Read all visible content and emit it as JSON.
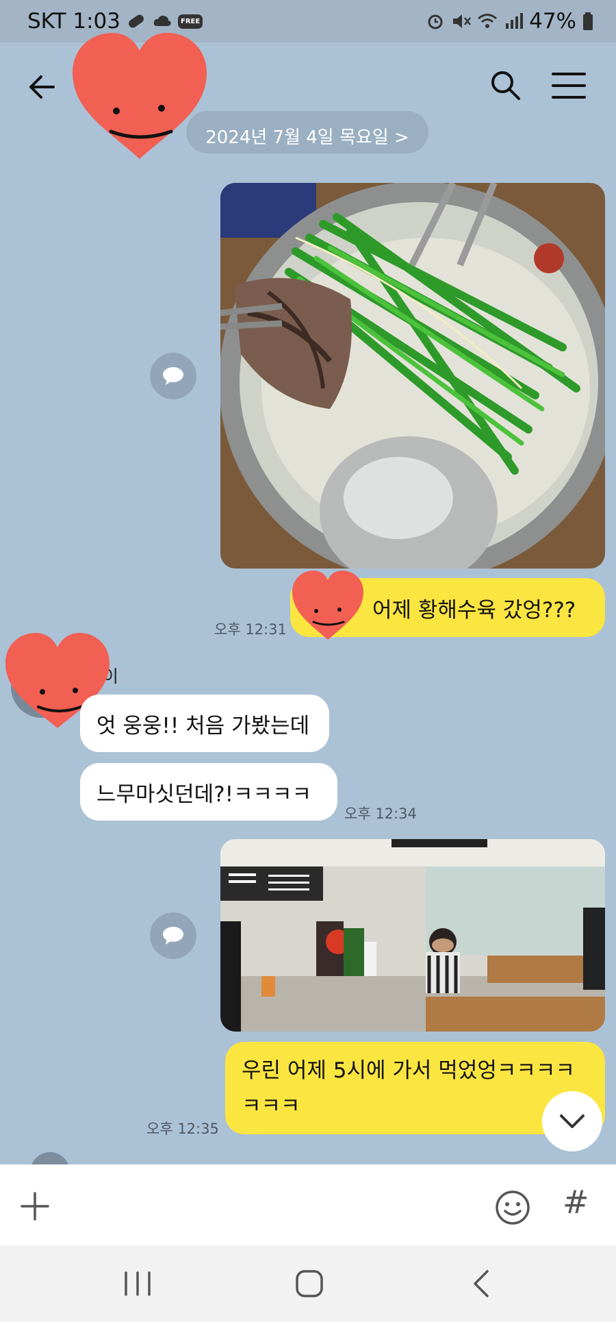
{
  "status_bar": {
    "carrier_time": "SKT 1:03",
    "battery": "47%",
    "free_badge": "FREE",
    "icons": [
      "pill-icon",
      "cloud-icon",
      "free-badge",
      "alarm-icon",
      "mute-icon",
      "wifi-icon",
      "signal-icon",
      "battery-icon"
    ]
  },
  "header": {
    "icons": {
      "back": "back-arrow-icon",
      "search": "search-icon",
      "menu": "hamburger-menu-icon"
    }
  },
  "date_divider": "2024년 7월 4일 목요일 >",
  "messages": [
    {
      "side": "me",
      "type": "photo",
      "subject": "hot-pot photo"
    },
    {
      "side": "me",
      "type": "text",
      "text": "어제 황해수육 갔엉???",
      "time": "오후 12:31"
    },
    {
      "side": "them",
      "sender": "이",
      "type": "text",
      "text": "엇 웅웅!! 처음 가봤는데"
    },
    {
      "side": "them",
      "type": "text",
      "text": "느무마싯던데?!ㅋㅋㅋㅋ",
      "time": "오후 12:34"
    },
    {
      "side": "me",
      "type": "photo",
      "subject": "restaurant interior photo"
    },
    {
      "side": "me",
      "type": "text",
      "line1": "우린 어제 5시에 가서 먹었엉ㅋㅋㅋㅋ",
      "line2": "ㅋㅋㅋ",
      "time": "오후 12:35"
    }
  ],
  "input_bar": {
    "hash": "#"
  },
  "colors": {
    "background": "#abc1d6",
    "my_bubble": "#fbe540",
    "their_bubble": "#ffffff",
    "sticker": "#f25f53"
  }
}
